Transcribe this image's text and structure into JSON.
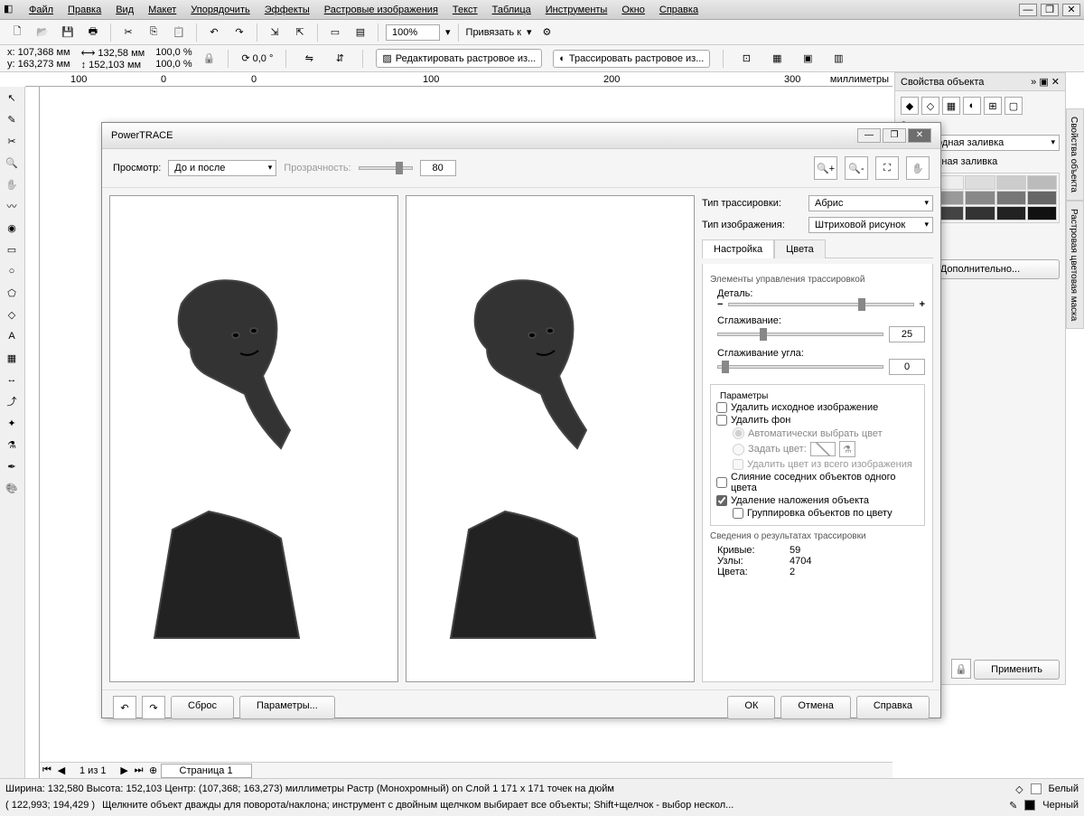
{
  "menu": {
    "file": "Файл",
    "edit": "Правка",
    "view": "Вид",
    "layout": "Макет",
    "arrange": "Упорядочить",
    "effects": "Эффекты",
    "bitmaps": "Растровые изображения",
    "text": "Текст",
    "table": "Таблица",
    "tools": "Инструменты",
    "window": "Окно",
    "help": "Справка"
  },
  "toolbar": {
    "zoom": "100%",
    "snap": "Привязать к"
  },
  "propbar": {
    "x_lbl": "x:",
    "x": "107,368 мм",
    "y_lbl": "y:",
    "y": "163,273 мм",
    "w": "132,58 мм",
    "h": "152,103 мм",
    "sx": "100,0",
    "sy": "100,0",
    "pct": "%",
    "rot": "0,0",
    "deg": "°",
    "edit_bitmap": "Редактировать растровое из...",
    "trace_bitmap": "Трассировать растровое из..."
  },
  "ruler": {
    "u": "миллиметры",
    "m100": "100",
    "m200": "200",
    "m300": "300",
    "m0": "0"
  },
  "rpanel": {
    "title": "Свойства объекта",
    "fill_label": "Заливка:",
    "fill_type": "Однородная заливка",
    "fill_type2": "Однородная заливка",
    "more": "Дополнительно..."
  },
  "vtabs": {
    "props": "Свойства объекта",
    "mask": "Растровая цветовая маска"
  },
  "apply_btn": "Применить",
  "dialog": {
    "title": "PowerTRACE",
    "preview_lbl": "Просмотр:",
    "preview_mode": "До и после",
    "opacity_lbl": "Прозрачность:",
    "opacity_val": "80",
    "trace_type_lbl": "Тип трассировки:",
    "trace_type": "Абрис",
    "image_type_lbl": "Тип изображения:",
    "image_type": "Штриховой рисунок",
    "tabs": {
      "settings": "Настройка",
      "colors": "Цвета"
    },
    "controls_header": "Элементы управления трассировкой",
    "detail_lbl": "Деталь:",
    "smoothing_lbl": "Сглаживание:",
    "smooth_val": "25",
    "corner_lbl": "Сглаживание угла:",
    "corner_val": "0",
    "params_header": "Параметры",
    "chk_delete_src": "Удалить исходное изображение",
    "chk_delete_bg": "Удалить фон",
    "r_auto_color": "Автоматически выбрать цвет",
    "r_set_color": "Задать цвет:",
    "chk_remove_color": "Удалить цвет из всего изображения",
    "chk_merge": "Слияние соседних объектов одного цвета",
    "chk_overlap": "Удаление наложения объекта",
    "chk_group": "Группировка объектов по цвету",
    "results_header": "Сведения о результатах трассировки",
    "curves_k": "Кривые:",
    "curves_v": "59",
    "nodes_k": "Узлы:",
    "nodes_v": "4704",
    "colors_k": "Цвета:",
    "colors_v": "2",
    "reset": "Сброс",
    "options": "Параметры...",
    "ok": "ОК",
    "cancel": "Отмена",
    "help": "Справка"
  },
  "status": {
    "l1": "Ширина: 132,580 Высота: 152,103 Центр: (107,368; 163,273) миллиметры   Растр (Монохромный) on Слой 1 171 x 171 точек на дюйм",
    "l2_coords": "( 122,993; 194,429 )",
    "l2_hint": "Щелкните объект дважды для поворота/наклона; инструмент с двойным щелчком выбирает все объекты; Shift+щелчок - выбор нескол...",
    "white": "Белый",
    "black": "Черный"
  },
  "pagenav": {
    "info": "1 из 1",
    "page": "Страница 1"
  }
}
